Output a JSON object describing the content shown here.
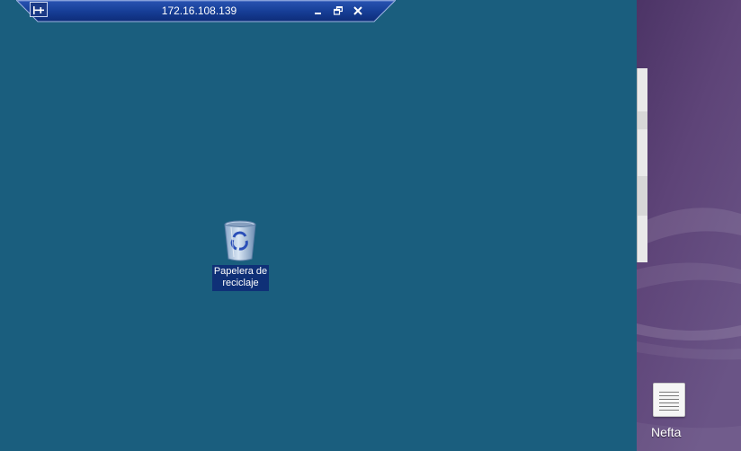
{
  "remote_session": {
    "connection_bar": {
      "title": "172.16.108.139",
      "pin_icon": "pin-icon",
      "minimize_icon": "minimize-icon",
      "restore_icon": "restore-icon",
      "close_icon": "close-icon"
    },
    "desktop": {
      "background_color": "#1a5e7e",
      "icons": [
        {
          "label": "Papelera de reciclaje",
          "icon": "recycle-bin-icon"
        }
      ]
    }
  },
  "host_desktop": {
    "background_color": "#5a3c72",
    "icons": [
      {
        "label": "Nefta",
        "icon": "text-file-icon"
      }
    ]
  }
}
